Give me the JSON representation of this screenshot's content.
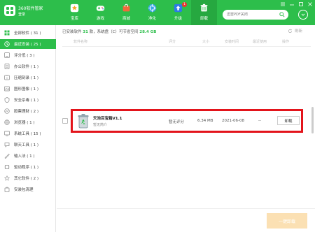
{
  "app": {
    "title": "360软件管家",
    "login": "登录"
  },
  "nav": [
    {
      "label": "宝库",
      "icon": "star-icon"
    },
    {
      "label": "游戏",
      "icon": "gamepad-icon"
    },
    {
      "label": "商城",
      "icon": "shopping-bag-icon"
    },
    {
      "label": "净化",
      "icon": "aperture-icon"
    },
    {
      "label": "升级",
      "icon": "upload-arrow-icon",
      "badge": "1"
    },
    {
      "label": "卸载",
      "icon": "trash-icon",
      "active": true
    }
  ],
  "search": {
    "placeholder": "迅雷PDF关闭"
  },
  "sidebar": {
    "items": [
      {
        "label": "全部软件 ( 31 )",
        "icon": "grid-icon"
      },
      {
        "label": "最近安装 ( 25 )",
        "icon": "clock-icon",
        "active": true
      },
      {
        "label": "评分低 ( 3 )",
        "icon": "rating-icon"
      },
      {
        "label": "办公软件 ( 1 )",
        "icon": "office-icon"
      },
      {
        "label": "压缩刻录 ( 1 )",
        "icon": "compress-icon"
      },
      {
        "label": "图形图像 ( 1 )",
        "icon": "image-icon"
      },
      {
        "label": "安全杀毒 ( 1 )",
        "icon": "shield-icon"
      },
      {
        "label": "股票理财 ( 2 )",
        "icon": "stock-icon"
      },
      {
        "label": "浏览器 ( 1 )",
        "icon": "browser-icon"
      },
      {
        "label": "系统工具 ( 15 )",
        "icon": "tools-icon"
      },
      {
        "label": "聊天工具 ( 1 )",
        "icon": "chat-icon"
      },
      {
        "label": "输入法 ( 1 )",
        "icon": "keyboard-icon"
      },
      {
        "label": "驱动程序 ( 1 )",
        "icon": "driver-icon"
      },
      {
        "label": "其它软件 ( 2 )",
        "icon": "other-icon"
      },
      {
        "label": "安装包清理",
        "icon": "cleanup-icon"
      }
    ]
  },
  "main": {
    "summary_prefix": "已安装软件",
    "summary_count": "31",
    "summary_mid": "款，系统盘（C）可节省空间",
    "summary_size": "28.4 GB",
    "refresh_label": "刷新",
    "columns": {
      "name": "软件名称",
      "rating": "评分",
      "size": "大小",
      "install_time": "安装时间",
      "last_used": "最近使用",
      "action": "操作"
    },
    "row": {
      "name": "天池百宝箱V1.1",
      "desc": "暂无简介",
      "rating": "暂无评分",
      "size": "6.34 MB",
      "install_date": "2021-06-08",
      "last_used": "--",
      "uninstall_label": "卸载"
    },
    "one_click_label": "一键卸载"
  }
}
